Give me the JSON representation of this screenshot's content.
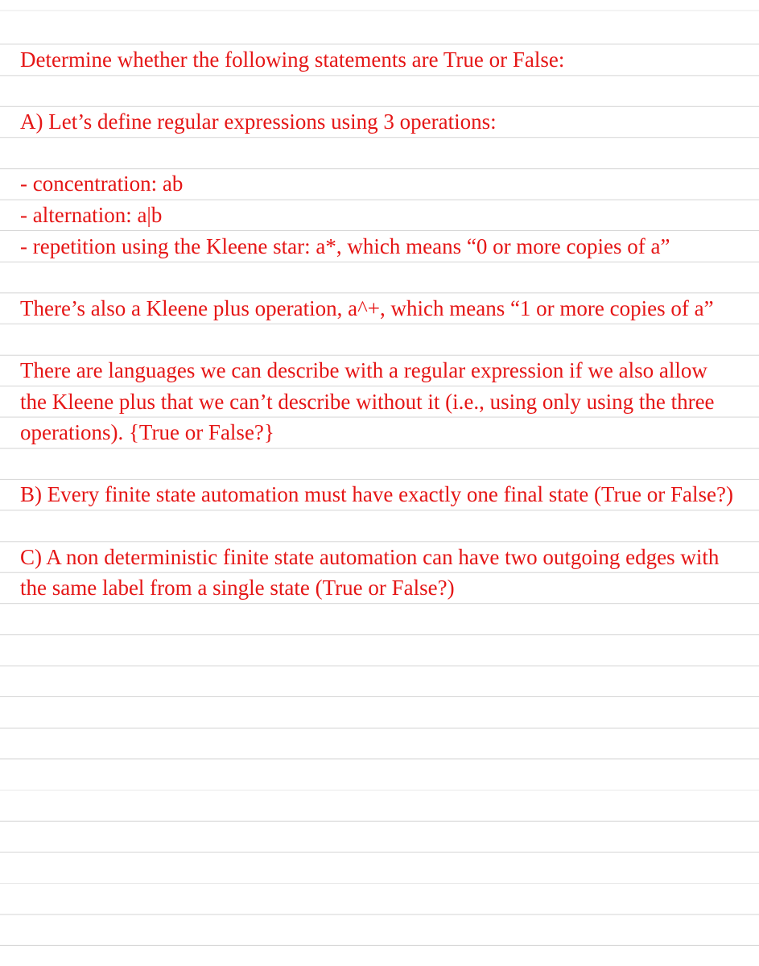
{
  "document": {
    "paragraphs": [
      "Determine whether the following statements are True or False:",
      "A) Let’s define regular expressions using 3 operations:",
      "- concentration: ab\n- alternation: a|b\n- repetition using the Kleene star: a*, which means “0 or more copies of a”",
      "There’s also a Kleene plus operation, a^+, which means “1 or more copies of a”",
      "There are languages we can describe with a regular expression if we also allow the Kleene plus that we can’t describe without it (i.e., using only using the three operations). {True or False?}",
      "B) Every finite state automation must have exactly one final state (True or False?)",
      "C) A non deterministic finite state automation can have two outgoing edges with the same label from a single state (True or False?)"
    ]
  }
}
